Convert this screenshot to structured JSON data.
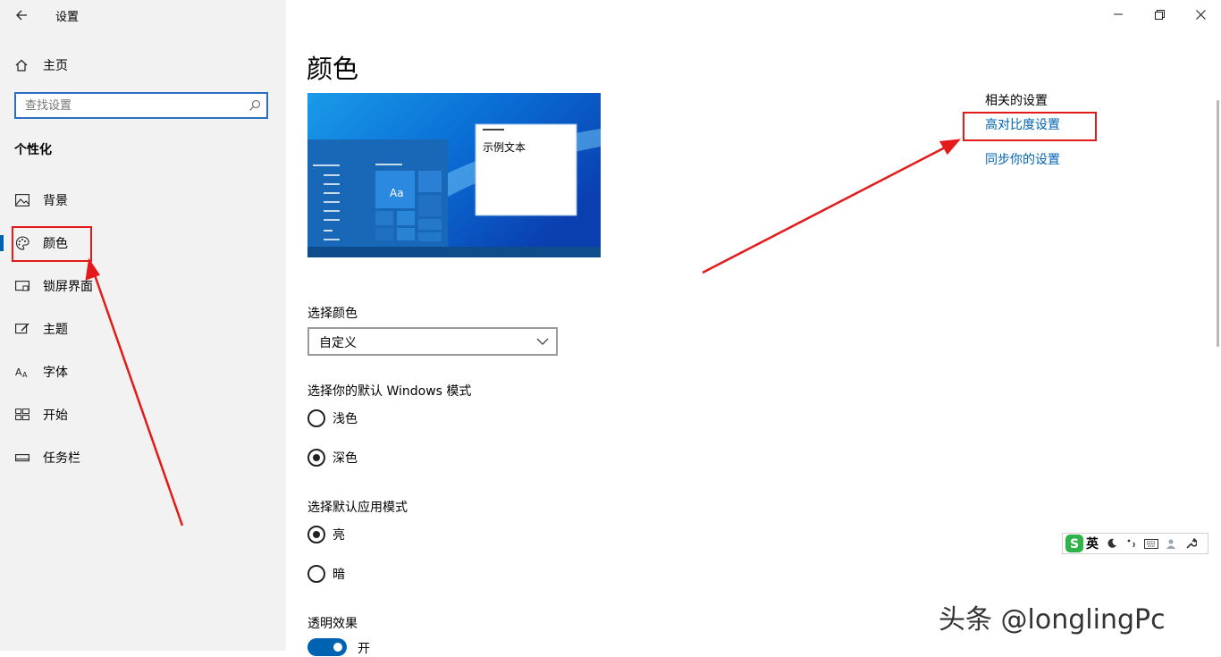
{
  "window": {
    "title": "设置"
  },
  "sidebar": {
    "home_label": "主页",
    "search_placeholder": "查找设置",
    "section_title": "个性化",
    "items": [
      {
        "label": "背景",
        "icon": "image-icon"
      },
      {
        "label": "颜色",
        "icon": "palette-icon",
        "active": true
      },
      {
        "label": "锁屏界面",
        "icon": "lock-screen-icon"
      },
      {
        "label": "主题",
        "icon": "theme-icon"
      },
      {
        "label": "字体",
        "icon": "font-icon"
      },
      {
        "label": "开始",
        "icon": "start-icon"
      },
      {
        "label": "任务栏",
        "icon": "taskbar-icon"
      }
    ]
  },
  "main": {
    "title": "颜色",
    "preview": {
      "sample_text": "示例文本",
      "tile_text": "Aa"
    },
    "choose_color": {
      "label": "选择颜色",
      "selected": "自定义"
    },
    "windows_mode": {
      "label": "选择你的默认 Windows 模式",
      "options": [
        {
          "label": "浅色",
          "checked": false
        },
        {
          "label": "深色",
          "checked": true
        }
      ]
    },
    "app_mode": {
      "label": "选择默认应用模式",
      "options": [
        {
          "label": "亮",
          "checked": true
        },
        {
          "label": "暗",
          "checked": false
        }
      ]
    },
    "transparency": {
      "label": "透明效果",
      "state_label": "开",
      "on": true
    }
  },
  "related": {
    "title": "相关的设置",
    "links": [
      "高对比度设置",
      "同步你的设置"
    ]
  },
  "ime": {
    "language": "英"
  },
  "watermark": "头条 @longlingPc",
  "colors": {
    "accent": "#0063b1",
    "highlight": "#e41a1a",
    "sidebar_bg": "#f2f2f2"
  }
}
